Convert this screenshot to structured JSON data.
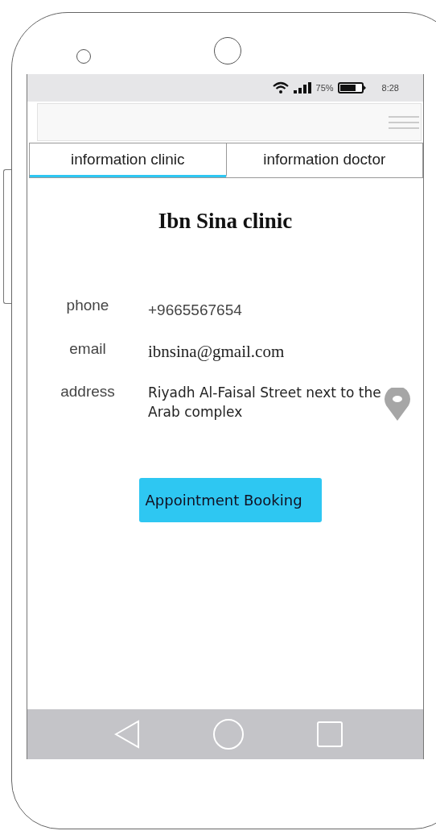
{
  "status_bar": {
    "battery": "75%",
    "time": "8:28"
  },
  "tabs": [
    {
      "label": "information clinic",
      "selected": true
    },
    {
      "label": "information doctor",
      "selected": false
    }
  ],
  "title": "Ibn Sina clinic",
  "details": [
    {
      "kind": "phone",
      "label": "phone",
      "value": "+9665567654"
    },
    {
      "kind": "email",
      "label": "email",
      "value": "ibnsina@gmail.com"
    },
    {
      "kind": "address",
      "label": "address",
      "value": "Riyadh Al-Faisal Street next to the Arab complex"
    }
  ],
  "button": "Appointment Booking"
}
